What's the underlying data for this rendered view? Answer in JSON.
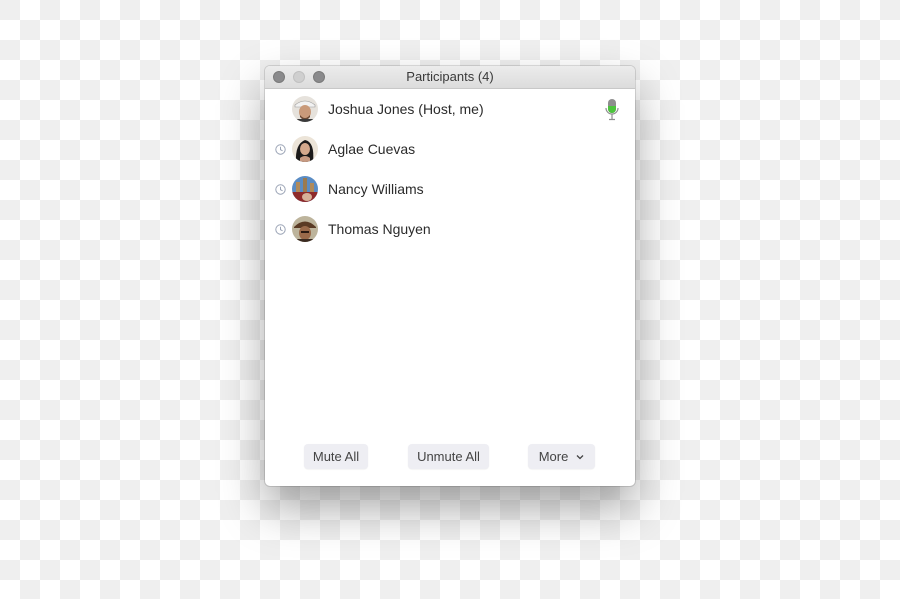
{
  "window": {
    "title": "Participants (4)",
    "traffic_lights": [
      "close",
      "minimize",
      "zoom"
    ]
  },
  "participants": [
    {
      "name": "Joshua Jones (Host, me)",
      "status_icon": null,
      "mic": "mic-active-icon",
      "avatar_colors": [
        "#d9c7b2",
        "#8a6a55",
        "#f0f0f0"
      ]
    },
    {
      "name": "Aglae Cuevas",
      "status_icon": "clock-icon",
      "mic": null,
      "avatar_colors": [
        "#e8ddd0",
        "#1c1a1a",
        "#c79a82"
      ]
    },
    {
      "name": "Nancy Williams",
      "status_icon": "clock-icon",
      "mic": null,
      "avatar_colors": [
        "#4a7bb5",
        "#b08a5a",
        "#8e2a2a"
      ]
    },
    {
      "name": "Thomas Nguyen",
      "status_icon": "clock-icon",
      "mic": null,
      "avatar_colors": [
        "#a9a08a",
        "#5a3a24",
        "#3a2a20"
      ]
    }
  ],
  "footer": {
    "mute_all": "Mute All",
    "unmute_all": "Unmute All",
    "more": "More"
  },
  "colors": {
    "mic_active": "#4cc43c",
    "clock": "#9aa3b5",
    "button_bg": "#eeeef3"
  }
}
